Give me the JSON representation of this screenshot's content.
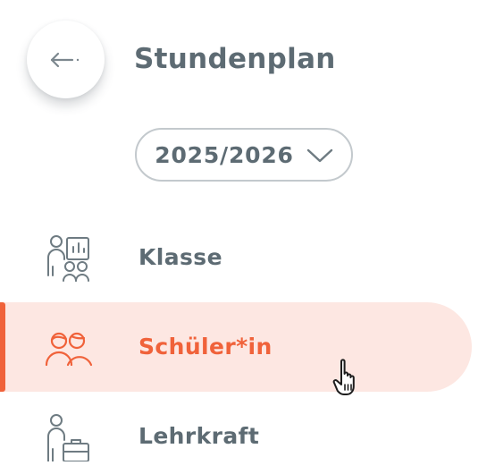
{
  "header": {
    "back_icon": "arrow-left-icon",
    "title": "Stundenplan"
  },
  "year_select": {
    "value": "2025/2026",
    "icon": "chevron-down-icon"
  },
  "nav": {
    "items": [
      {
        "label": "Klasse",
        "icon": "class-presentation-icon",
        "active": false
      },
      {
        "label": "Schüler*in",
        "icon": "students-icon",
        "active": true
      },
      {
        "label": "Lehrkraft",
        "icon": "teacher-briefcase-icon",
        "active": false
      }
    ]
  },
  "colors": {
    "text": "#5d6b73",
    "accent": "#f0623a",
    "active_bg": "#fde7e2",
    "border": "#c3c9cd"
  }
}
